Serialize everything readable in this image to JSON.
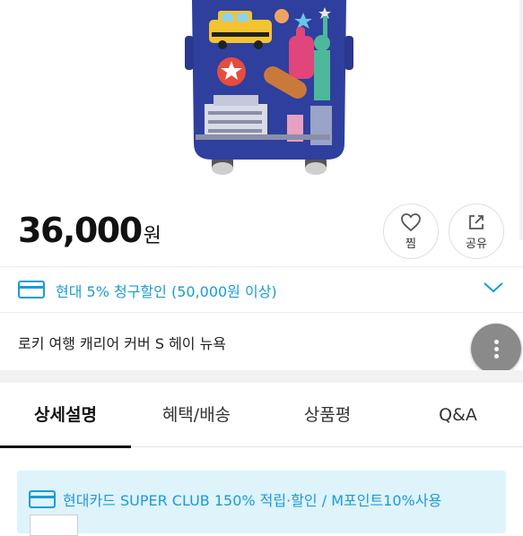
{
  "product": {
    "image_alt": "suitcase-cover-ny-pattern",
    "price": "36,000",
    "price_unit": "원",
    "name": "로키 여행 캐리어 커버 S 헤이 뉴욕"
  },
  "actions": {
    "wish_label": "찜",
    "share_label": "공유"
  },
  "discount": {
    "text": "현대 5% 청구할인 (50,000원 이상)"
  },
  "tabs": [
    {
      "label": "상세설명",
      "active": true
    },
    {
      "label": "혜택/배송",
      "active": false
    },
    {
      "label": "상품평",
      "active": false
    },
    {
      "label": "Q&A",
      "active": false
    }
  ],
  "banner": {
    "text": "현대카드 SUPER CLUB 150% 적립·할인 / M포인트10%사용"
  },
  "colors": {
    "accent_blue": "#1a9bd7",
    "banner_bg": "#dff3fb",
    "cover_blue": "#2f3f9e"
  },
  "icons": {
    "wish": "heart-icon",
    "share": "share-icon",
    "card": "credit-card-icon",
    "expand": "chevron-down-icon",
    "more": "more-vertical-icon"
  }
}
